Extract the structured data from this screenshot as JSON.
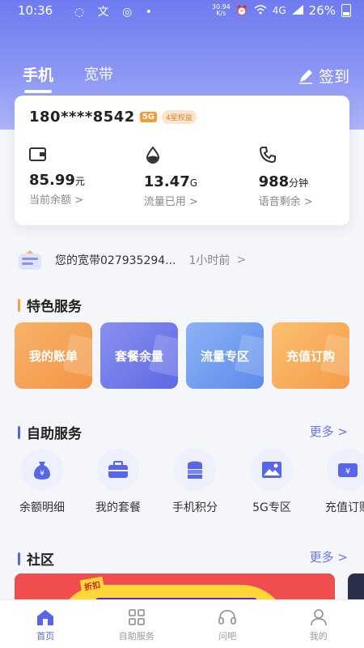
{
  "status_bar": {
    "time": "10:36",
    "speed": "30.94\nK/s",
    "network": "4G",
    "battery": "26%"
  },
  "tabs": [
    {
      "label": "手机"
    },
    {
      "label": "宽带"
    }
  ],
  "signin_label": "签到",
  "account": {
    "phone": "180****8542",
    "badge_5g": "5G",
    "badge_star": "4星权益",
    "balance_value": "85.99",
    "balance_unit": "元",
    "balance_label": "当前余额 >",
    "data_value": "13.47",
    "data_unit": "G",
    "data_label": "流量已用 >",
    "voice_value": "988",
    "voice_unit": "分钟",
    "voice_label": "语音剩余 >"
  },
  "notice": {
    "text": "您的宽带027935294...",
    "time": "1小时前",
    "arrow": ">"
  },
  "featured": {
    "title": "特色服务",
    "items": [
      {
        "label": "我的账单",
        "color": "#f6a04f"
      },
      {
        "label": "套餐余量",
        "color": "#6f76ea"
      },
      {
        "label": "流量专区",
        "color": "#6f9af0"
      },
      {
        "label": "充值订购",
        "color": "#f8aa5a"
      }
    ]
  },
  "self_service": {
    "title": "自助服务",
    "more": "更多 >",
    "items": [
      {
        "label": "余额明细",
        "icon": "money-bag-icon"
      },
      {
        "label": "我的套餐",
        "icon": "briefcase-icon"
      },
      {
        "label": "手机积分",
        "icon": "coins-icon"
      },
      {
        "label": "5G专区",
        "icon": "image-icon"
      },
      {
        "label": "充值订购",
        "icon": "wallet-icon"
      }
    ]
  },
  "community": {
    "title": "社区",
    "more": "更多 >",
    "banner_tag": "折扣"
  },
  "bottom_nav": [
    {
      "label": "首页",
      "icon": "home-icon"
    },
    {
      "label": "自助服务",
      "icon": "grid-icon"
    },
    {
      "label": "问吧",
      "icon": "headset-icon"
    },
    {
      "label": "我的",
      "icon": "user-icon"
    }
  ],
  "colors": {
    "accent": "#5a66e8",
    "hero": "#7a84f2",
    "orange": "#f6a04f"
  }
}
